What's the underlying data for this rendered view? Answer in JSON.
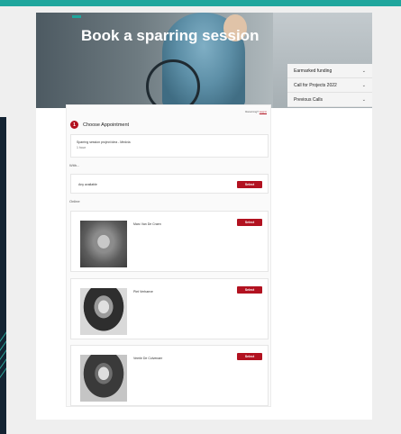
{
  "hero": {
    "title": "Book a sparring session"
  },
  "side_menu": {
    "items": [
      {
        "label": "Earmarked funding",
        "icon": "chevron-down-icon"
      },
      {
        "label": "Call for Projects 2022",
        "icon": "chevron-down-icon"
      },
      {
        "label": "Previous Calls",
        "icon": "chevron-down-icon"
      }
    ]
  },
  "booking": {
    "returning_prefix": "Returning?",
    "login_link": "Log in",
    "step": {
      "number": "1",
      "title": "Choose Appointment"
    },
    "service": {
      "name": "Sparring session project idea - Medvia",
      "duration": "1 hour"
    },
    "with_label": "With...",
    "any": {
      "label": "Any available",
      "button": "Select"
    },
    "online_label": "Online",
    "staff": [
      {
        "name": "Marc Van De Craen",
        "button": "Select"
      },
      {
        "name": "Piet Verhaeve",
        "button": "Select"
      },
      {
        "name": "Veerle De Colvenaer",
        "button": "Select"
      }
    ]
  },
  "colors": {
    "accent_teal": "#1fa69d",
    "select_red": "#b21220",
    "dark_navy": "#142433"
  }
}
